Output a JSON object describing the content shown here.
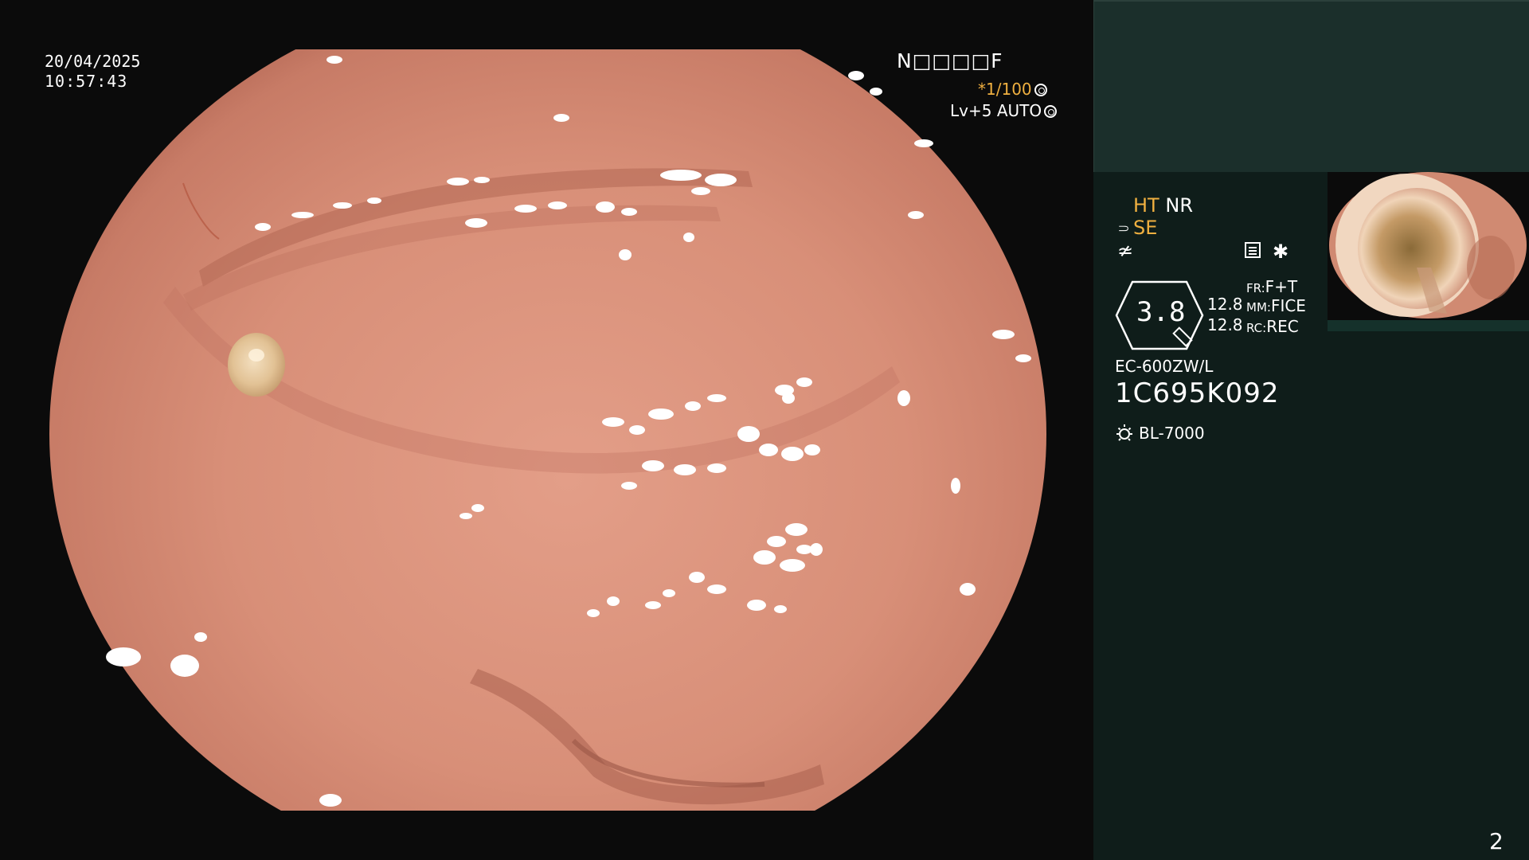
{
  "overlay": {
    "date": "20/04/2025",
    "time": "10:57:43",
    "patient_id": "N□□□□F",
    "shutter": "*1/100",
    "iris": "Lv+5 AUTO"
  },
  "panel": {
    "ht_label": "HT",
    "nr_label": "NR",
    "se_label": "SE",
    "zoom_value": "3.8",
    "param1": "12.8",
    "param2": "12.8",
    "fr_label": "FR:",
    "fr_value": "F+T",
    "mm_label": "MM:",
    "mm_value": "FICE",
    "rc_label": "RC:",
    "rc_value": "REC",
    "scope_model": "EC-600ZW/L",
    "scope_serial": "1C695K092",
    "light_source": "BL-7000",
    "page_number": "2"
  },
  "colors": {
    "accent_yellow": "#f0b040",
    "panel_bg": "#0f1d1a",
    "panel_top_bg": "#1b2f2b",
    "mucosa": "#d9947d"
  },
  "icons": [
    "record-shutter-icon",
    "iris-icon",
    "structure-enhance-icon",
    "sharpness-icon",
    "layout-icon",
    "star-icon",
    "zoom-hexagon-icon",
    "light-source-icon"
  ]
}
